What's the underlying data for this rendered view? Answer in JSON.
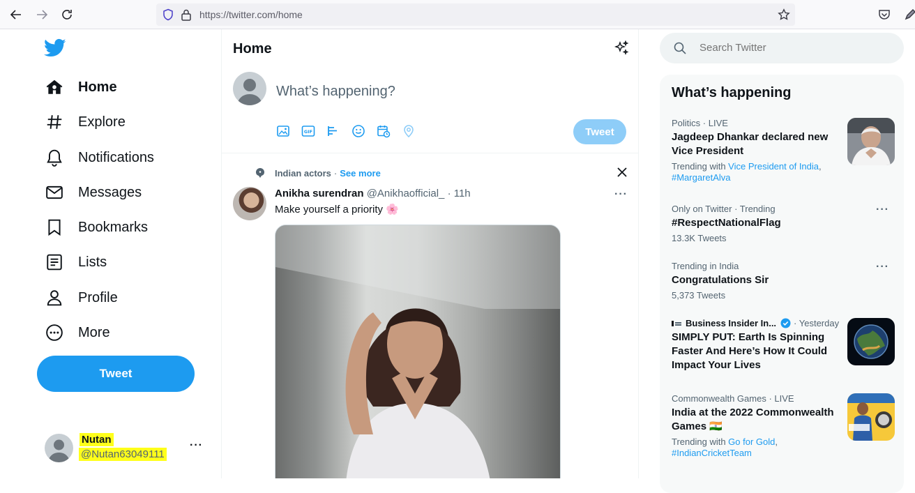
{
  "browser": {
    "url": "https://twitter.com/home"
  },
  "sidebar": {
    "items": [
      {
        "label": "Home",
        "icon": "home-icon"
      },
      {
        "label": "Explore",
        "icon": "hashtag-icon"
      },
      {
        "label": "Notifications",
        "icon": "bell-icon"
      },
      {
        "label": "Messages",
        "icon": "mail-icon"
      },
      {
        "label": "Bookmarks",
        "icon": "bookmark-icon"
      },
      {
        "label": "Lists",
        "icon": "list-icon"
      },
      {
        "label": "Profile",
        "icon": "person-icon"
      },
      {
        "label": "More",
        "icon": "more-circle-icon"
      }
    ],
    "tweet_button": "Tweet",
    "account": {
      "name": "Nutan",
      "handle": "@Nutan63049111",
      "more": "···"
    }
  },
  "main": {
    "title": "Home",
    "compose": {
      "placeholder": "What’s happening?",
      "tweet_button": "Tweet"
    },
    "topic": {
      "name": "Indian actors",
      "sep": "·",
      "see_more": "See more"
    },
    "post": {
      "name": "Anikha surendran",
      "handle": "@Anikhaofficial_",
      "sep": "·",
      "time": "11h",
      "text": "Make yourself a priority 🌸",
      "more": "···"
    }
  },
  "search": {
    "placeholder": "Search Twitter"
  },
  "trends": {
    "title": "What’s happening",
    "items": [
      {
        "meta": "Politics · LIVE",
        "headline": "Jagdeep Dhankar declared new Vice President",
        "trending_prefix": "Trending with ",
        "link1": "Vice President of India",
        "comma": ",",
        "link2": "#MargaretAlva"
      },
      {
        "meta": "Only on Twitter · Trending",
        "headline": "#RespectNationalFlag",
        "count": "13.3K Tweets"
      },
      {
        "meta": "Trending in India",
        "headline": "Congratulations Sir",
        "count": "5,373 Tweets"
      },
      {
        "source": "Business Insider In...",
        "meta": "· Yesterday",
        "headline": "SIMPLY PUT: Earth Is Spinning Faster And Here’s How It Could Impact Your Lives"
      },
      {
        "meta": "Commonwealth Games · LIVE",
        "headline": "India at the 2022 Commonwealth Games 🇮🇳",
        "trending_prefix": "Trending with ",
        "link1": "Go for Gold",
        "comma": ",",
        "link2": "#IndianCricketTeam"
      }
    ],
    "more_dots": "···"
  },
  "colors": {
    "accent": "#1d9bf0",
    "highlight": "#ffff1a",
    "muted": "#536471"
  }
}
